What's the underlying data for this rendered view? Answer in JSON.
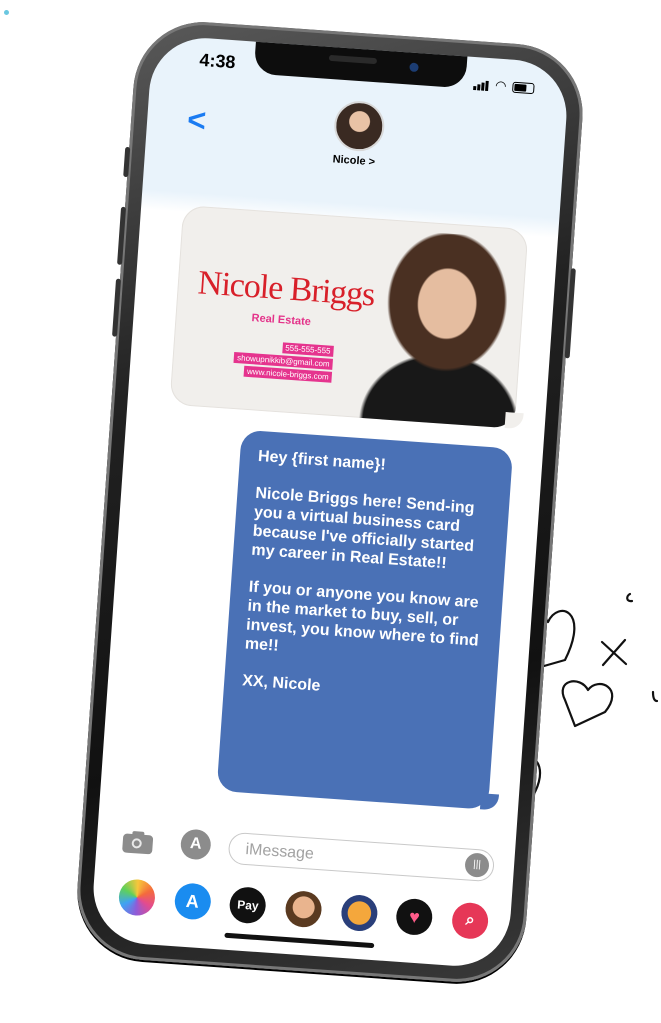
{
  "status_bar": {
    "time": "4:38"
  },
  "header": {
    "contact_name": "Nicole >",
    "back_glyph": "<"
  },
  "card": {
    "name": "Nicole Briggs",
    "subtitle": "Real Estate",
    "lines": [
      "555-555-555",
      "showupnikkib@gmail.com",
      "www.nicole-briggs.com"
    ]
  },
  "message": {
    "paragraphs": [
      "Hey {first name}!",
      "Nicole Briggs here! Send-ing you a virtual business card because I've officially started my career in Real Estate!!",
      "If you or anyone you know are in the market to buy, sell, or invest, you know where to find me!!",
      "XX, Nicole"
    ]
  },
  "composer": {
    "placeholder": "iMessage"
  },
  "app_tray": [
    {
      "icon": "photos-icon",
      "label": ""
    },
    {
      "icon": "app-store-icon",
      "label": ""
    },
    {
      "icon": "apple-pay-icon",
      "label": "Pay"
    },
    {
      "icon": "memoji-icon",
      "label": ""
    },
    {
      "icon": "animoji-icon",
      "label": ""
    },
    {
      "icon": "heart-app-icon",
      "label": ""
    },
    {
      "icon": "search-images-icon",
      "label": ""
    }
  ],
  "colors": {
    "bubble_blue": "#4a71b6",
    "brand_red": "#d8202a",
    "brand_pink": "#e5348e",
    "ios_blue": "#1a7bf2"
  }
}
